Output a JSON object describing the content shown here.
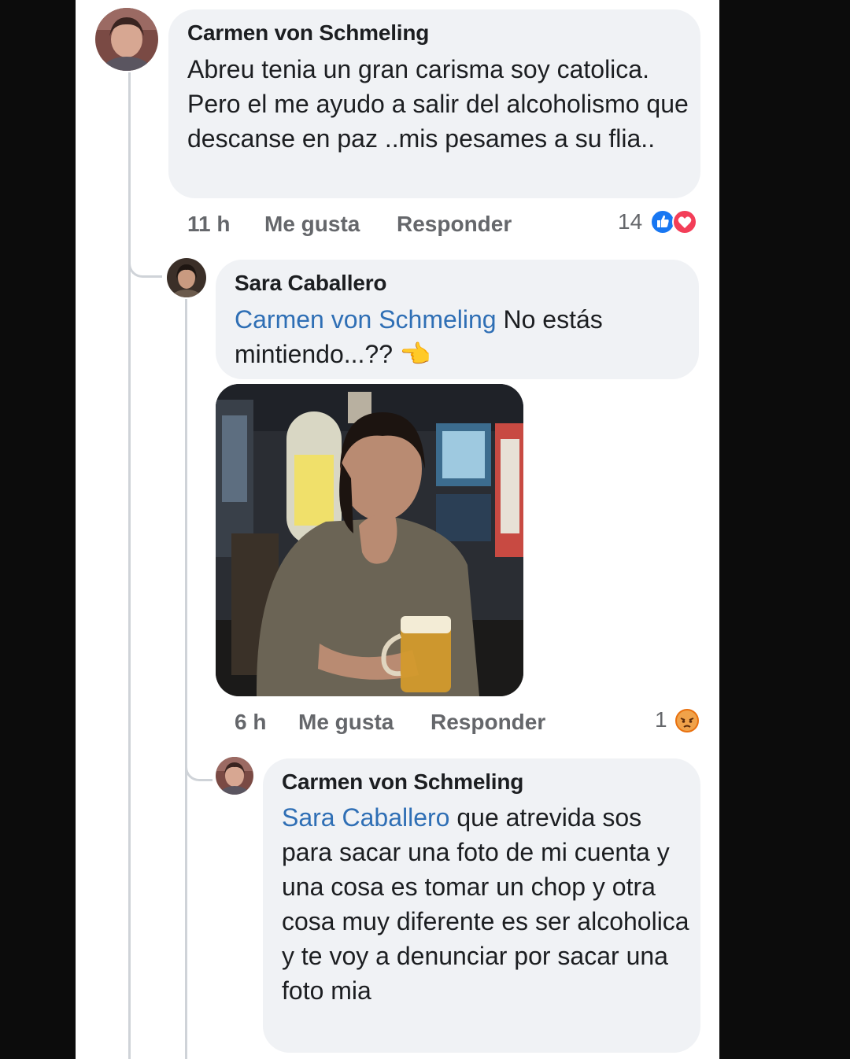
{
  "comments": [
    {
      "author": "Carmen von Schmeling",
      "text": "Abreu tenia un gran carisma soy catolica. Pero el me ayudo a salir del alcoholismo que descanse en paz ..mis pesames a su flia..",
      "time": "11 h",
      "like_label": "Me gusta",
      "reply_label": "Responder",
      "reaction_count": "14",
      "reactions": [
        "like-icon",
        "love-icon"
      ]
    },
    {
      "author": "Sara Caballero",
      "mention": "Carmen von Schmeling",
      "text": " No estás mintiendo...??",
      "emoji": "👈",
      "time": "6 h",
      "like_label": "Me gusta",
      "reply_label": "Responder",
      "reaction_count": "1",
      "reactions": [
        "angry-icon"
      ]
    },
    {
      "author": "Carmen von Schmeling",
      "mention": "Sara Caballero",
      "text": " que atrevida sos para sacar una foto de mi cuenta y una cosa es tomar un chop y otra cosa muy diferente es ser alcoholica y te voy a denunciar por sacar una foto mia"
    }
  ],
  "colors": {
    "mention": "#2f6fb5",
    "like_blue": "#1877f2",
    "love_red": "#f33e58",
    "angry_orange": "#e9710f",
    "bubble": "#f0f2f5"
  }
}
